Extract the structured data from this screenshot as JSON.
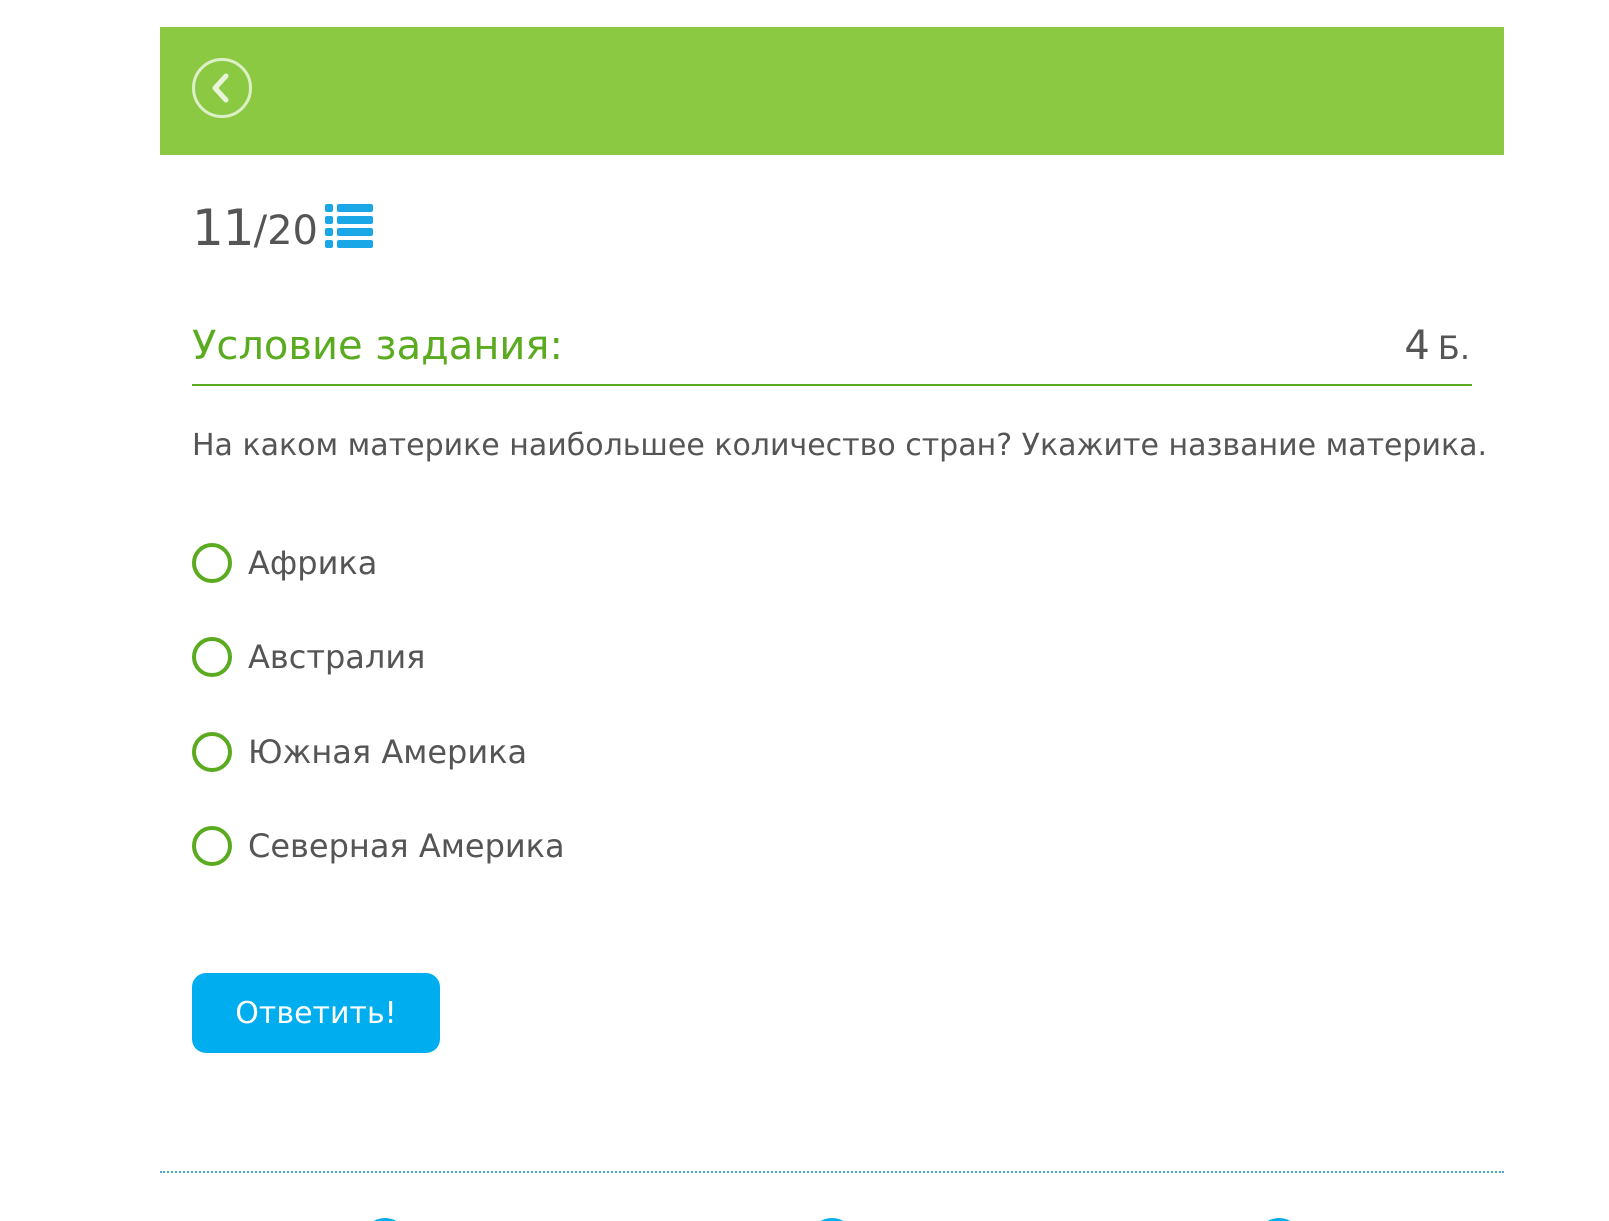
{
  "header": {
    "back_icon": "chevron-left-circle-icon",
    "background_color": "#8cc943"
  },
  "progress": {
    "current": "11",
    "separator": "/",
    "total": "20",
    "list_icon": "list-icon",
    "list_icon_color": "#1aa7e8"
  },
  "task": {
    "title": "Условие задания:",
    "points": "4",
    "points_unit": "Б.",
    "accent_color": "#5aab1f"
  },
  "question": {
    "text": "На каком материке наибольшее количество стран? Укажите название материка."
  },
  "options": [
    {
      "label": "Африка"
    },
    {
      "label": "Австралия"
    },
    {
      "label": "Южная Америка"
    },
    {
      "label": "Северная Америка"
    }
  ],
  "submit": {
    "label": "Ответить!",
    "color": "#00aeef"
  }
}
